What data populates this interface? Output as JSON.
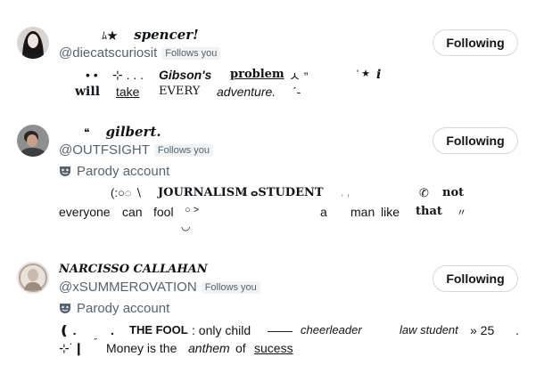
{
  "accounts": [
    {
      "name_deco": "ﾑ★",
      "name": "spencer!",
      "handle": "@diecatscuriosit",
      "follows_you": "Follows you",
      "follow_label": "Following",
      "bio": {
        "l1_a": "• •",
        "l1_b": "⊹ . . .",
        "l1_c": "Gibson's",
        "l1_d": "problem",
        "l1_e": "ㅅ ”",
        "l1_f": "' ★",
        "l1_g": "i",
        "l2_a": "will",
        "l2_b": "take",
        "l2_c": "EVERY",
        "l2_d": "adventure.",
        "l2_e": "ˊ-"
      }
    },
    {
      "name_deco": "❝",
      "name": "gilbert.",
      "handle": "@OUTFSIGHT",
      "follows_you": "Follows you",
      "follow_label": "Following",
      "parody": "Parody account",
      "bio": {
        "l1_a": "(:○◌ ∖",
        "l1_b": "JOURNALISM",
        "l1_c": "ՙ",
        "l1_d": "ⴰSTUDENT",
        "l1_e": "˒ ˒",
        "l1_f": "✆",
        "l1_g": "not",
        "l2_a": "everyone",
        "l2_b": "can",
        "l2_c": "fool",
        "l2_d": "○ ˃",
        "l2_e": "a",
        "l2_f": "man",
        "l2_g": "like",
        "l2_h": "that",
        "l2_i": "〃",
        "l3": "◡"
      }
    },
    {
      "name": "NARCISSO CALLAHAN",
      "handle": "@xSUMMEROVATION",
      "follows_you": "Follows you",
      "follow_label": "Following",
      "parody": "Parody account",
      "bio": {
        "l1_a": "❪ .",
        "l1_b": ".",
        "l1_c": "THE FOOL",
        "l1_d": ": only child",
        "l1_e": "——",
        "l1_f": "cheerleader",
        "l1_g": "law student",
        "l1_h": "» 25",
        "l1_i": ".",
        "l2_a": "⊹˙❙",
        "l2_b": "˝",
        "l2_c": "Money is the",
        "l2_d": "anthem",
        "l2_e": "of",
        "l2_f": "sucess"
      }
    }
  ],
  "colors": {
    "secondary_text": "#536471",
    "border": "#cfd9de",
    "badge_bg": "#eff3f4"
  },
  "icons": [
    "avatar",
    "theater-mask-icon"
  ]
}
